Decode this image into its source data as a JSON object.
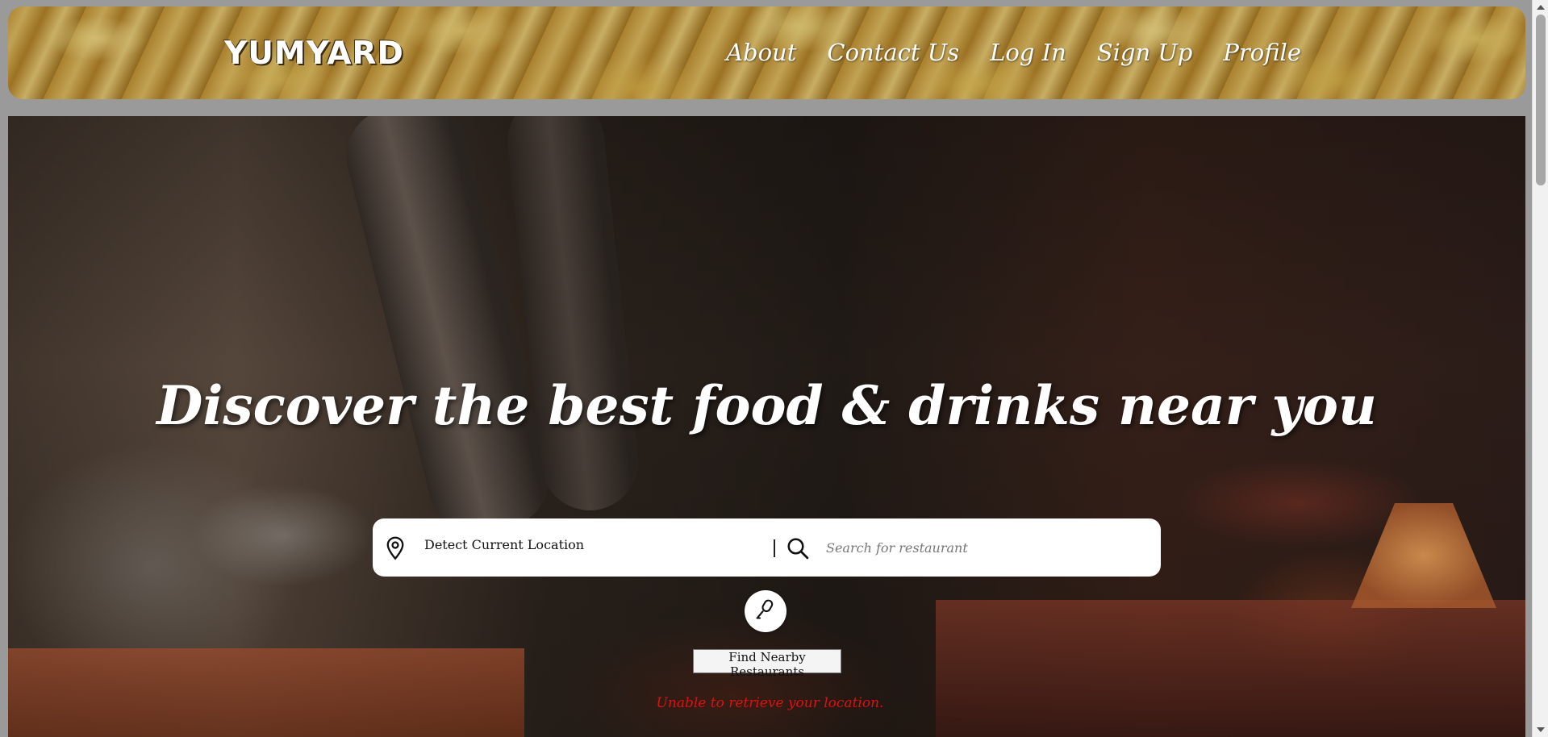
{
  "header": {
    "logo": "YUMYARD",
    "nav": [
      {
        "label": "About"
      },
      {
        "label": "Contact Us"
      },
      {
        "label": "Log In"
      },
      {
        "label": "Sign Up"
      },
      {
        "label": "Profile"
      }
    ]
  },
  "hero": {
    "title": "Discover the best food & drinks near you",
    "location_label": "Detect Current Location",
    "search_placeholder": "Search for restaurant",
    "find_button": "Find Nearby Restaurants",
    "error_message": "Unable to retrieve your location."
  },
  "icons": {
    "location": "map-pin-icon",
    "search": "magnifier-icon",
    "mic": "microphone-icon"
  },
  "colors": {
    "error": "#e01010",
    "search_bg": "#ffffff"
  }
}
